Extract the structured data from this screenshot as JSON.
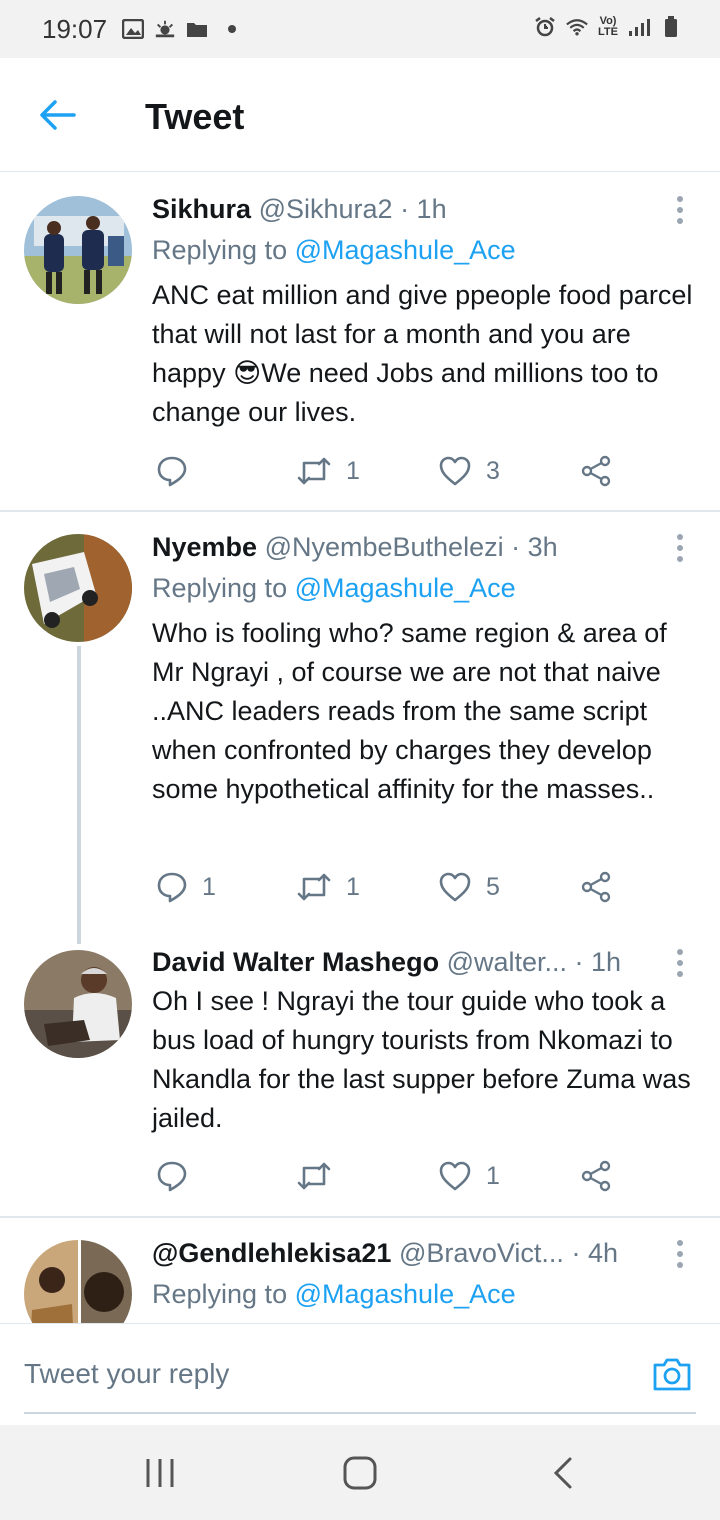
{
  "status_bar": {
    "time": "19:07",
    "network": "Vo)\nLTE"
  },
  "header": {
    "title": "Tweet"
  },
  "tweets": [
    {
      "name": "Sikhura",
      "handle": "@Sikhura2",
      "time": "· 1h",
      "replying_prefix": "Replying to ",
      "replying_to": "@Magashule_Ace",
      "text": "ANC eat million  and give ppeople food parcel that will not last for a month and you are happy 😎We need Jobs and millions too to change our lives.",
      "replies": "",
      "retweets": "1",
      "likes": "3"
    },
    {
      "name": "Nyembe",
      "handle": "@NyembeButhelezi",
      "time": "· 3h",
      "replying_prefix": "Replying to ",
      "replying_to": "@Magashule_Ace",
      "text": "Who is fooling who? same region & area of Mr Ngrayi , of course we are not that naive ..ANC leaders reads from the same script when confronted by charges they develop some hypothetical affinity for the masses..",
      "replies": "1",
      "retweets": "1",
      "likes": "5"
    },
    {
      "name": "David Walter Mashego",
      "handle": "@walter...",
      "time": "· 1h",
      "text": "Oh I see ! Ngrayi the tour guide who took a bus load of hungry tourists from Nkomazi to Nkandla for the last supper before Zuma was jailed.",
      "replies": "",
      "retweets": "",
      "likes": "1"
    },
    {
      "name": "@Gendlehlekisa21",
      "handle": "@BravoVict...",
      "time": "· 4h",
      "replying_prefix": "Replying to ",
      "replying_to": "@Magashule_Ace"
    }
  ],
  "composer": {
    "placeholder": "Tweet your reply"
  },
  "colors": {
    "accent": "#1da1f2",
    "secondary_text": "#657786",
    "divider": "#e1e8ed"
  }
}
